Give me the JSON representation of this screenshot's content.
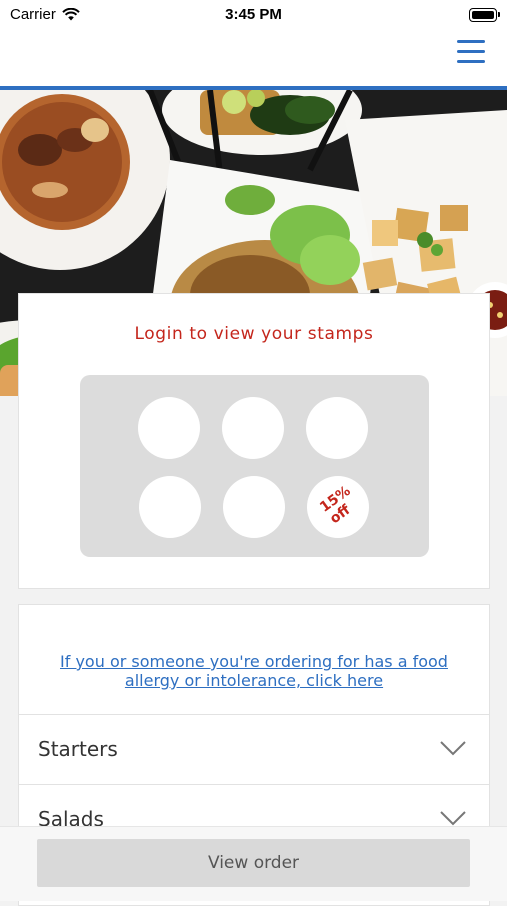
{
  "status_bar": {
    "carrier": "Carrier",
    "time": "3:45 PM"
  },
  "header": {
    "menu_icon": "hamburger-menu-icon"
  },
  "hero": {
    "image": "food-dishes-photo"
  },
  "stamps": {
    "title": "Login to view your stamps",
    "total_slots": 6,
    "collected": 0,
    "reward_line1": "15%",
    "reward_line2": "off"
  },
  "menu": {
    "allergy_link": "If you or someone you're ordering for has a food allergy or intolerance, click here",
    "categories": [
      {
        "label": "Starters"
      },
      {
        "label": "Salads"
      }
    ]
  },
  "footer": {
    "button_label": "View order"
  },
  "colors": {
    "accent": "#2e6fc1",
    "brand_red": "#c4261c",
    "button_bg": "#d9d9d9"
  }
}
